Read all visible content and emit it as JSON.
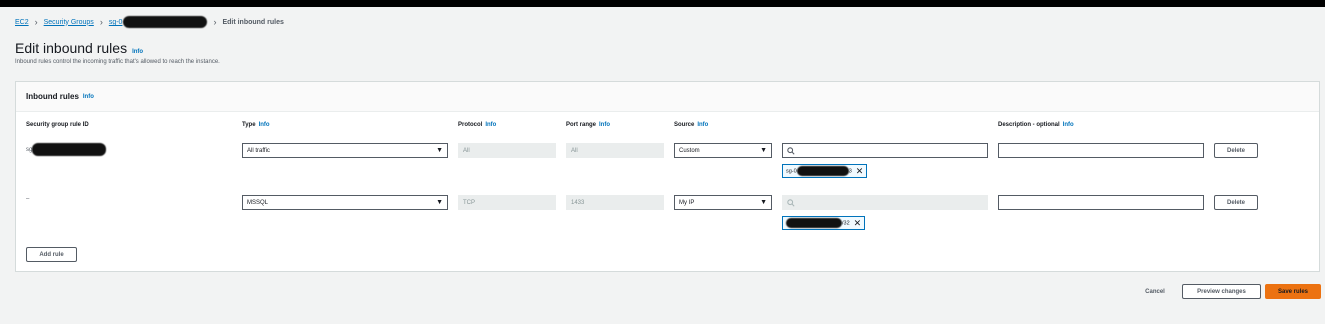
{
  "breadcrumb": {
    "items": [
      "EC2",
      "Security Groups",
      "sg-0"
    ],
    "current": "Edit inbound rules"
  },
  "page": {
    "title": "Edit inbound rules",
    "info": "Info",
    "description": "Inbound rules control the incoming traffic that's allowed to reach the instance."
  },
  "panel": {
    "title": "Inbound rules",
    "info": "Info"
  },
  "columns": {
    "rule_id": "Security group rule ID",
    "type": "Type",
    "protocol": "Protocol",
    "port_range": "Port range",
    "source": "Source",
    "description": "Description - optional",
    "info": "Info"
  },
  "rows": [
    {
      "rule_id": "sg-",
      "type": "All traffic",
      "protocol": "All",
      "port_range": "All",
      "source": "Custom",
      "search_placeholder": "",
      "token": "sg-0",
      "token_suffix": "3",
      "description": "",
      "delete_label": "Delete"
    },
    {
      "rule_id": "–",
      "type": "MSSQL",
      "protocol": "TCP",
      "port_range": "1433",
      "source": "My IP",
      "search_placeholder": "",
      "token": "/32",
      "token_suffix": "",
      "description": "",
      "delete_label": "Delete"
    }
  ],
  "add_rule_label": "Add rule",
  "footer": {
    "cancel": "Cancel",
    "preview": "Preview changes",
    "save": "Save rules"
  },
  "icons": {
    "search": "search-icon",
    "caret": "caret-down-icon",
    "remove": "close-icon",
    "breadcrumb_separator": "chevron-right-icon"
  },
  "colors": {
    "link": "#0073bb",
    "primary_button": "#ec7211",
    "token_border": "#0073bb"
  }
}
